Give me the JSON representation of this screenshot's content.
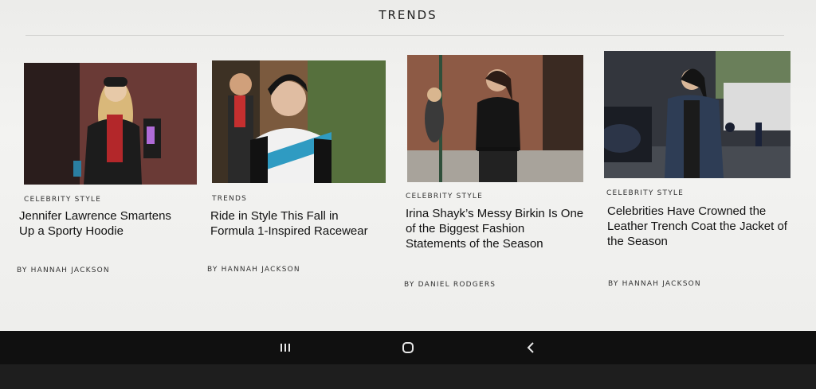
{
  "section": {
    "title": "TRENDS"
  },
  "articles": [
    {
      "kicker": "CELEBRITY STYLE",
      "headline": "Jennifer Lawrence Smartens Up a Sporty Hoodie",
      "byline": "BY HANNAH JACKSON"
    },
    {
      "kicker": "TRENDS",
      "headline": "Ride in Style This Fall in Formula 1-Inspired Racewear",
      "byline": "BY HANNAH JACKSON"
    },
    {
      "kicker": "CELEBRITY STYLE",
      "headline": "Irina Shayk’s Messy Birkin Is One of the Biggest Fashion Statements of the Season",
      "byline": "BY DANIEL RODGERS"
    },
    {
      "kicker": "CELEBRITY STYLE",
      "headline": "Celebrities Have Crowned the Leather Trench Coat the Jacket of the Season",
      "byline": "BY HANNAH JACKSON"
    }
  ],
  "navbar": {
    "icons": [
      "recent-apps-icon",
      "home-icon",
      "back-icon"
    ]
  }
}
